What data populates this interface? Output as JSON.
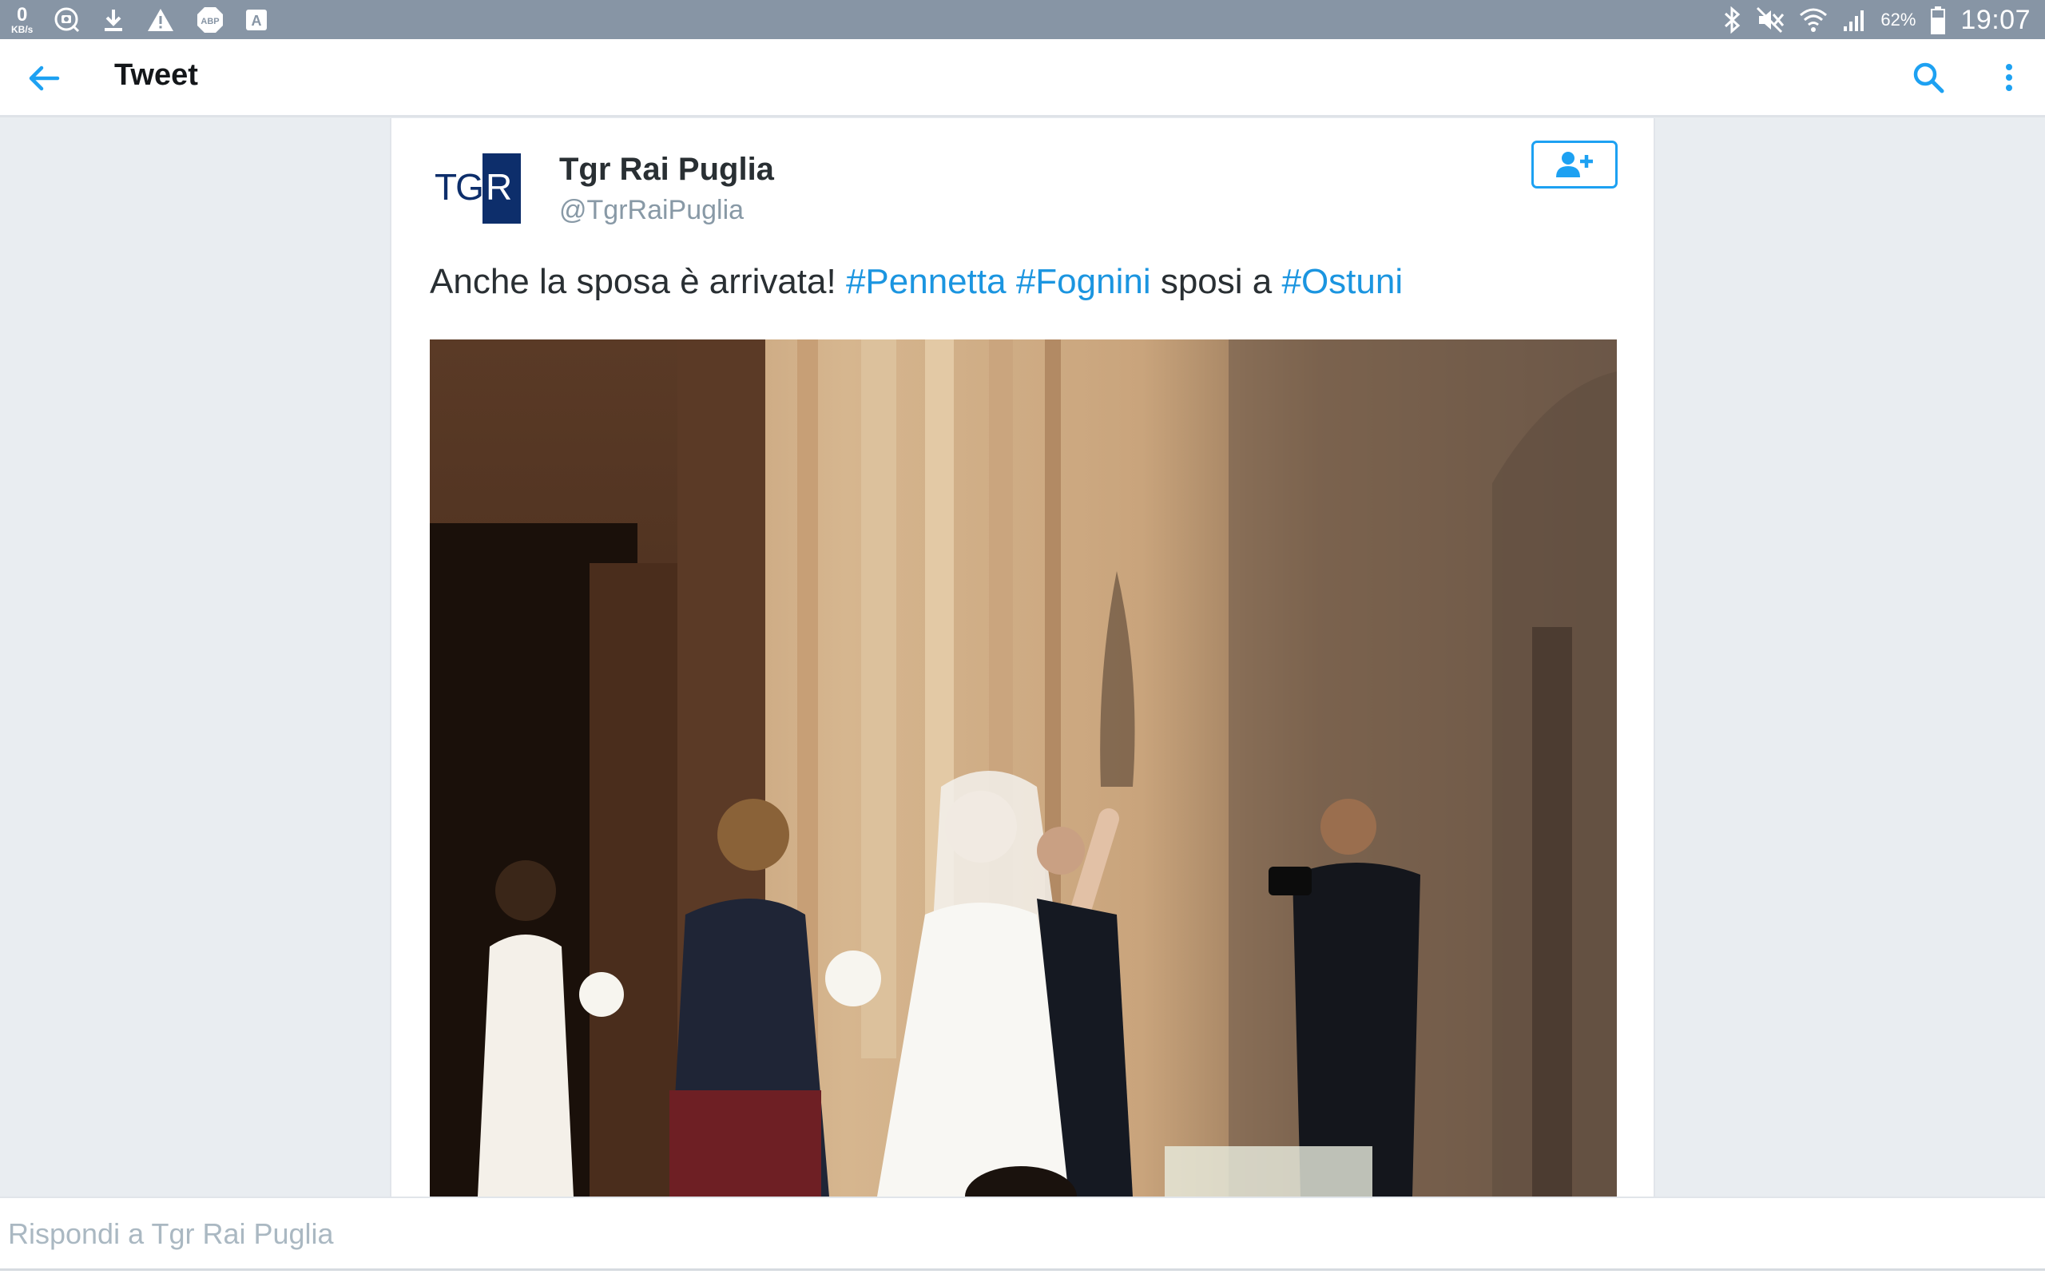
{
  "status_bar": {
    "net_speed_value": "0",
    "net_speed_unit": "KB/s",
    "left_icons": [
      "camera-badge-icon",
      "download-icon",
      "warning-icon",
      "adblock-icon",
      "a-badge-icon"
    ],
    "adblock_label": "ABP",
    "a_label": "A",
    "right_icons": [
      "bluetooth-icon",
      "mute-icon",
      "wifi-icon",
      "signal-icon",
      "battery-icon"
    ],
    "battery_percent": "62%",
    "time": "19:07"
  },
  "app_bar": {
    "title": "Tweet"
  },
  "tweet": {
    "author_name": "Tgr Rai Puglia",
    "author_handle": "@TgrRaiPuglia",
    "avatar_text": "TGR",
    "text_parts": {
      "t1": "Anche la sposa è arrivata! ",
      "h1": "#Pennetta",
      "sp1": " ",
      "h2": "#Fognini",
      "t2": " sposi a ",
      "h3": "#Ostuni"
    }
  },
  "reply": {
    "placeholder": "Rispondi a Tgr Rai Puglia"
  },
  "colors": {
    "status_bar": "#8795a5",
    "accent": "#1da1f2",
    "hashtag": "#1b95e0",
    "text": "#292f33",
    "muted": "#8899a6",
    "page_bg": "#e9edf1"
  }
}
